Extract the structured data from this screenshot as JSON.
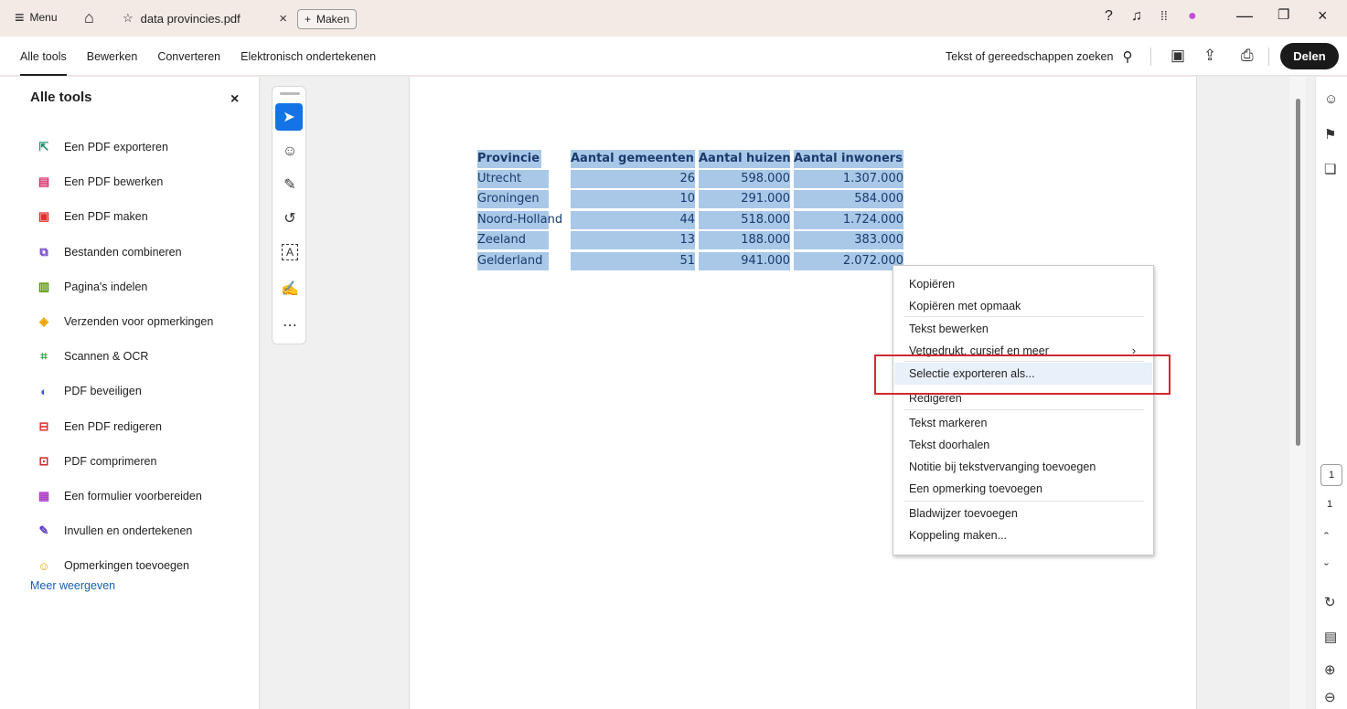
{
  "titlebar": {
    "menu_label": "Menu",
    "tab_title": "data provincies.pdf",
    "new_label": "Maken"
  },
  "toolbar": {
    "tabs": [
      "Alle tools",
      "Bewerken",
      "Converteren",
      "Elektronisch ondertekenen"
    ],
    "search_label": "Tekst of gereedschappen zoeken",
    "share_label": "Delen"
  },
  "leftpanel": {
    "title": "Alle tools",
    "items": [
      {
        "label": "Een PDF exporteren",
        "icon": "export-pdf-icon",
        "color": "#1e8a6e"
      },
      {
        "label": "Een PDF bewerken",
        "icon": "edit-pdf-icon",
        "color": "#d6336c"
      },
      {
        "label": "Een PDF maken",
        "icon": "create-pdf-icon",
        "color": "#e03131"
      },
      {
        "label": "Bestanden combineren",
        "icon": "combine-files-icon",
        "color": "#6f42c1"
      },
      {
        "label": "Pagina's indelen",
        "icon": "organize-pages-icon",
        "color": "#5c940d"
      },
      {
        "label": "Verzenden voor opmerkingen",
        "icon": "send-comments-icon",
        "color": "#e8a400"
      },
      {
        "label": "Scannen & OCR",
        "icon": "scan-ocr-icon",
        "color": "#2f9e44"
      },
      {
        "label": "PDF beveiligen",
        "icon": "protect-pdf-icon",
        "color": "#3b5bdb"
      },
      {
        "label": "Een PDF redigeren",
        "icon": "redact-pdf-icon",
        "color": "#e03131"
      },
      {
        "label": "PDF comprimeren",
        "icon": "compress-pdf-icon",
        "color": "#c92a2a"
      },
      {
        "label": "Een formulier voorbereiden",
        "icon": "prepare-form-icon",
        "color": "#ae3ec9"
      },
      {
        "label": "Invullen en ondertekenen",
        "icon": "fill-sign-icon",
        "color": "#5f3dc4"
      },
      {
        "label": "Opmerkingen toevoegen",
        "icon": "comment-icon",
        "color": "#e8a400"
      }
    ],
    "more_label": "Meer weergeven"
  },
  "table": {
    "headers": [
      "Provincie",
      "Aantal gemeenten",
      "Aantal huizen",
      "Aantal inwoners"
    ],
    "rows": [
      [
        "Utrecht",
        "26",
        "598.000",
        "1.307.000"
      ],
      [
        "Groningen",
        "10",
        "291.000",
        "584.000"
      ],
      [
        "Noord-Holland",
        "44",
        "518.000",
        "1.724.000"
      ],
      [
        "Zeeland",
        "13",
        "188.000",
        "383.000"
      ],
      [
        "Gelderland",
        "51",
        "941.000",
        "2.072.000"
      ]
    ]
  },
  "context_menu": {
    "items": [
      "Kopiëren",
      "Kopiëren met opmaak",
      "Tekst bewerken",
      "Vetgedrukt, cursief en meer",
      "Selectie exporteren als...",
      "Redigeren",
      "Tekst markeren",
      "Tekst doorhalen",
      "Notitie bij tekstvervanging toevoegen",
      "Een opmerking toevoegen",
      "Bladwijzer toevoegen",
      "Koppeling maken..."
    ],
    "submenu_arrow": "›"
  },
  "page_nav": {
    "current": "1",
    "total": "1"
  },
  "colors": {
    "selection": "#a9c8e8",
    "accent": "#1473e6",
    "highlight_box": "#d0282e"
  }
}
